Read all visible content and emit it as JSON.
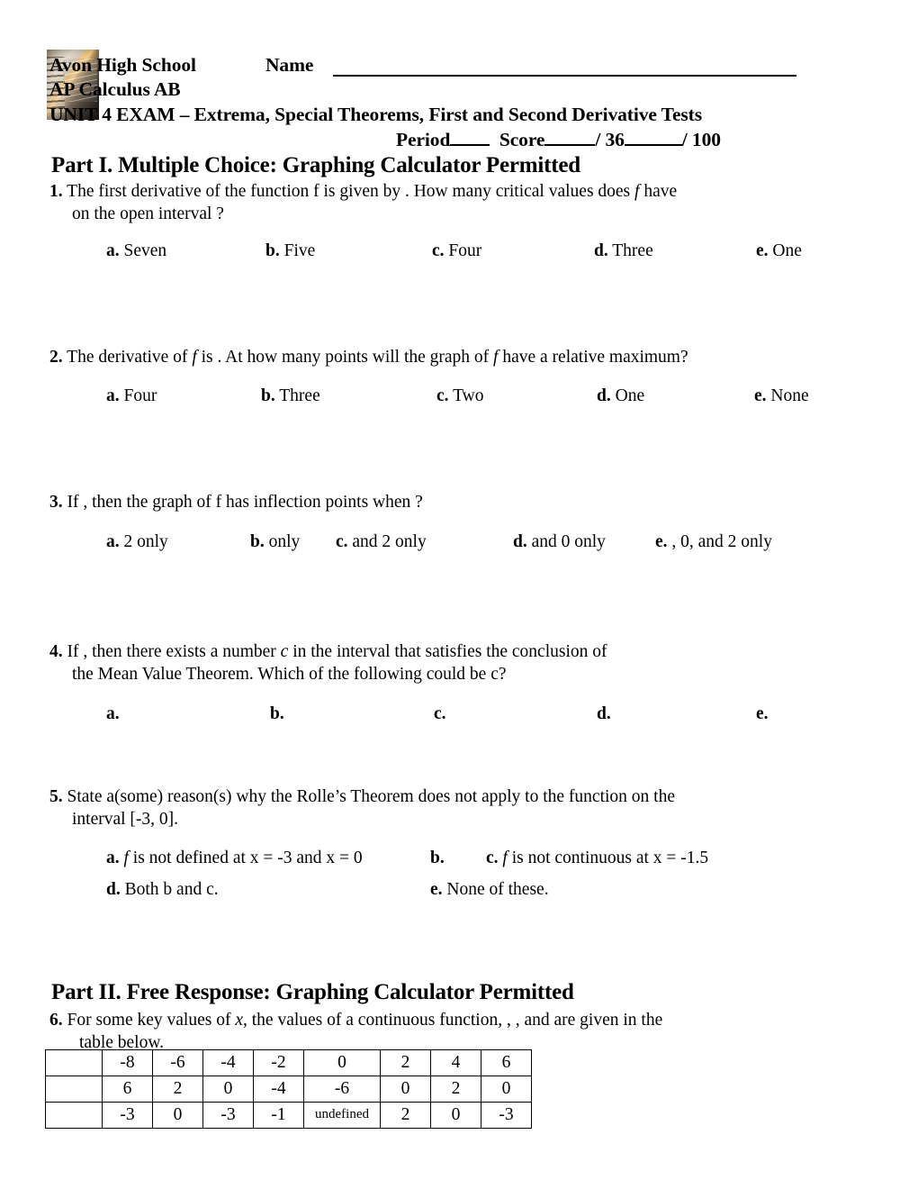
{
  "header": {
    "school": "Avon High School",
    "name_label": "Name",
    "course": "AP Calculus AB",
    "unit_title": "UNIT 4 EXAM – Extrema, Special Theorems, First and Second Derivative Tests",
    "period_label": "Period",
    "score_label": "Score",
    "score_out_of": "/ 36",
    "total_out_of": "/ 100",
    "logo_image": "notebook-pencil-photo"
  },
  "part1": {
    "heading": "Part I.  Multiple Choice:  Graphing Calculator Permitted"
  },
  "part2": {
    "heading": "Part II. Free Response:  Graphing Calculator Permitted"
  },
  "questions": [
    {
      "number": "1.",
      "line1": "The first derivative of the function f is given by .  How many critical values does",
      "line1_italic": "f",
      "line1_tail": "have",
      "line2": "on the open interval ?",
      "choices": [
        {
          "letter": "a.",
          "text": "Seven"
        },
        {
          "letter": "b.",
          "text": "Five"
        },
        {
          "letter": "c.",
          "text": "Four"
        },
        {
          "letter": "d.",
          "text": "Three"
        },
        {
          "letter": "e.",
          "text": "One"
        }
      ]
    },
    {
      "number": "2.",
      "line1_a": "The derivative of",
      "line1_italic": "f",
      "line1_b": "is .  At how many points will the graph of",
      "line1_italic2": "f",
      "line1_c": "have a relative maximum?",
      "choices": [
        {
          "letter": "a.",
          "text": "Four"
        },
        {
          "letter": "b.",
          "text": "Three"
        },
        {
          "letter": "c.",
          "text": "Two"
        },
        {
          "letter": "d.",
          "text": "One"
        },
        {
          "letter": "e.",
          "text": "None"
        }
      ]
    },
    {
      "number": "3.",
      "line1": "If , then the graph of f has inflection points when  ?",
      "choices": [
        {
          "letter": "a.",
          "text": "2 only"
        },
        {
          "letter": "b.",
          "text": "only"
        },
        {
          "letter": "c.",
          "text": "and 2 only"
        },
        {
          "letter": "d.",
          "text": "and 0 only"
        },
        {
          "letter": "e.",
          "text": ", 0, and 2 only"
        }
      ]
    },
    {
      "number": "4.",
      "line1_a": "If , then there exists  a number",
      "line1_italic": "c",
      "line1_b": "in the interval  that satisfies the conclusion of",
      "line2_a": "the Mean Value Theorem.  Which of the following could be",
      "line2_italic": "c",
      "line2_b": "?",
      "choices": [
        {
          "letter": "a.",
          "text": ""
        },
        {
          "letter": "b.",
          "text": ""
        },
        {
          "letter": "c.",
          "text": ""
        },
        {
          "letter": "d.",
          "text": ""
        },
        {
          "letter": "e.",
          "text": ""
        }
      ]
    },
    {
      "number": "5.",
      "line1": "State a(some) reason(s) why the Rolle’s Theorem does not apply to the function  on the",
      "line2": "interval [-3, 0].",
      "choices": [
        {
          "letter": "a.",
          "italic": "f",
          "text": "is not defined at x = -3 and x = 0"
        },
        {
          "letter": "b.",
          "text": ""
        },
        {
          "letter": "c.",
          "italic": "f",
          "text": "is not continuous at x = -1.5"
        },
        {
          "letter": "d.",
          "text": "Both b and c."
        },
        {
          "letter": "e.",
          "text": "None of these."
        }
      ]
    },
    {
      "number": "6.",
      "line1_a": "For some key values of",
      "line1_italic": "x",
      "line1_b": ", the values of  a continuous function, , , and  are given in the",
      "line2": "table below."
    }
  ],
  "value_table": {
    "rows": [
      {
        "label": "",
        "values": [
          "-8",
          "-6",
          "-4",
          "-2",
          "0",
          "2",
          "4",
          "6"
        ]
      },
      {
        "label": "",
        "values": [
          "6",
          "2",
          "0",
          "-4",
          "-6",
          "0",
          "2",
          "0"
        ]
      },
      {
        "label": "",
        "values": [
          "-3",
          "0",
          "-3",
          "-1",
          "undefined",
          "2",
          "0",
          "-3"
        ]
      }
    ]
  }
}
